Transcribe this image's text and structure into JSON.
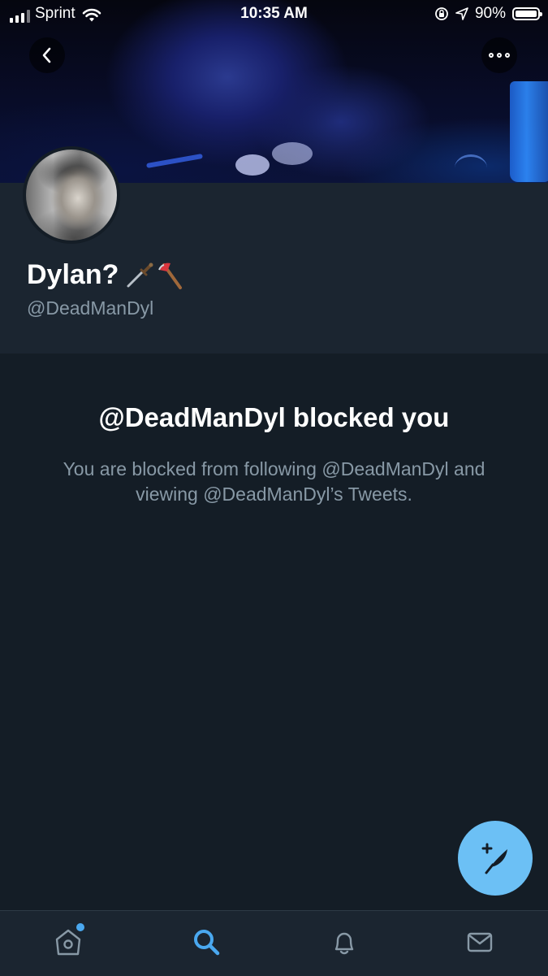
{
  "status_bar": {
    "carrier": "Sprint",
    "time": "10:35 AM",
    "battery": "90%"
  },
  "header": {
    "back_icon": "chevron-left-icon",
    "more_icon": "more-horizontal-icon"
  },
  "profile": {
    "name": "Dylan?",
    "name_emojis": "🗡️🪓",
    "handle": "@DeadManDyl"
  },
  "blocked": {
    "title": "@DeadManDyl blocked you",
    "description": "You are blocked from following @DeadManDyl and viewing @DeadManDyl’s Tweets."
  },
  "fab": {
    "icon": "compose-tweet-icon"
  },
  "tab_bar": {
    "items": [
      {
        "icon": "home-icon",
        "active": false,
        "has_badge": true
      },
      {
        "icon": "search-icon",
        "active": true,
        "has_badge": false
      },
      {
        "icon": "bell-icon",
        "active": false,
        "has_badge": false
      },
      {
        "icon": "mail-icon",
        "active": false,
        "has_badge": false
      }
    ]
  },
  "colors": {
    "background": "#141d26",
    "surface": "#1b2530",
    "accent": "#1da1f2",
    "fab": "#6cc0f5",
    "secondary_text": "#8899a6"
  }
}
